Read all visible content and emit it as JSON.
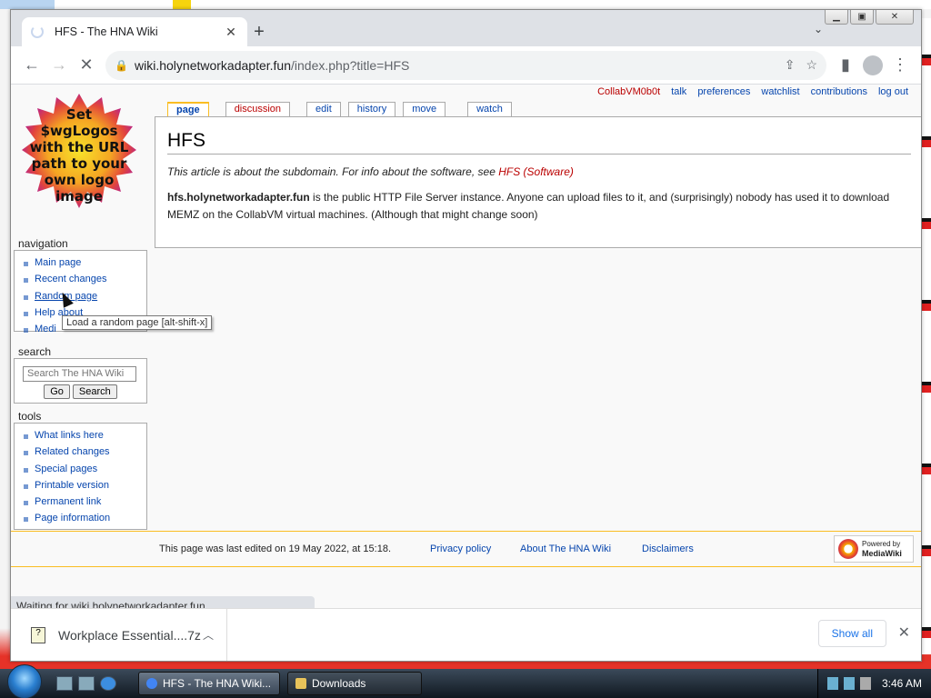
{
  "browser": {
    "tab_title": "HFS - The HNA Wiki",
    "url_host": "wiki.holynetworkadapter.fun",
    "url_path": "/index.php?title=HFS"
  },
  "wiki": {
    "logo_text": "Set $wgLogos with the URL path to your own logo image",
    "personal": {
      "user": "CollabVM0b0t",
      "talk": "talk",
      "preferences": "preferences",
      "watchlist": "watchlist",
      "contributions": "contributions",
      "logout": "log out"
    },
    "tabs": {
      "page": "page",
      "discussion": "discussion",
      "edit": "edit",
      "history": "history",
      "move": "move",
      "watch": "watch"
    },
    "title": "HFS",
    "hatnote_prefix": "This article is about the subdomain. For info about the software, see ",
    "hatnote_link": "HFS (Software)",
    "body_bold": "hfs.holynetworkadapter.fun",
    "body_rest": " is the public HTTP File Server instance. Anyone can upload files to it, and (surprisingly) nobody has used it to download MEMZ on the CollabVM virtual machines. (Although that might change soon)",
    "navigation": {
      "heading": "navigation",
      "items": [
        "Main page",
        "Recent changes",
        "Random page",
        "Help about",
        "Medi"
      ]
    },
    "search": {
      "heading": "search",
      "placeholder": "Search The HNA Wiki",
      "go": "Go",
      "search": "Search"
    },
    "tools": {
      "heading": "tools",
      "items": [
        "What links here",
        "Related changes",
        "Special pages",
        "Printable version",
        "Permanent link",
        "Page information"
      ]
    },
    "tooltip": "Load a random page [alt-shift-x]",
    "footer": {
      "lastmod": "This page was last edited on 19 May 2022, at 15:18.",
      "privacy": "Privacy policy",
      "about": "About The HNA Wiki",
      "disclaimers": "Disclaimers",
      "powered_small": "Powered by",
      "powered_name": "MediaWiki"
    }
  },
  "status_text": "Waiting for wiki.holynetworkadapter.fun...",
  "downloads": {
    "item_name": "Workplace Essential....7z",
    "show_all": "Show all"
  },
  "taskbar": {
    "task_active": "HFS - The HNA Wiki...",
    "task_other": "Downloads",
    "clock": "3:46 AM"
  }
}
